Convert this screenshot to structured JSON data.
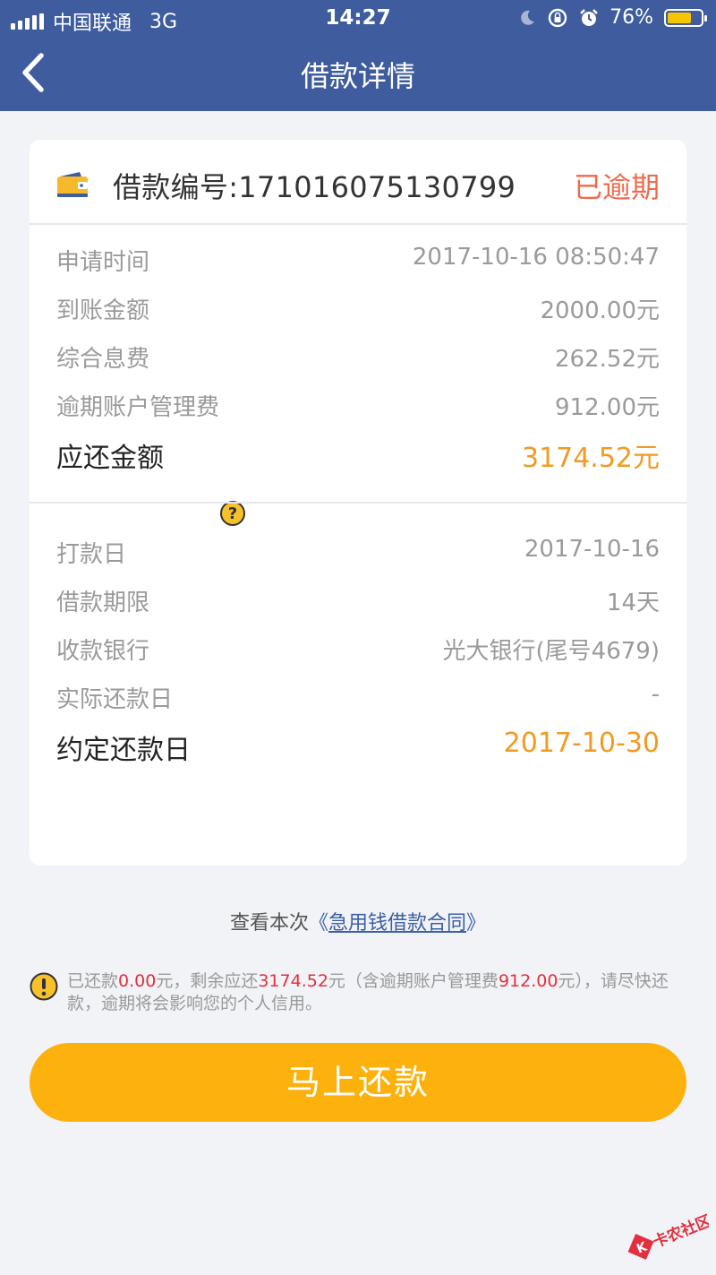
{
  "status_bar": {
    "carrier": "中国联通",
    "network": "3G",
    "time": "14:27",
    "battery": "76%",
    "battery_level": 0.76
  },
  "nav": {
    "title": "借款详情"
  },
  "card": {
    "loan_no": "借款编号:171016075130799",
    "status": "已逾期",
    "section1": [
      {
        "label": "申请时间",
        "value": "2017-10-16 08:50:47"
      },
      {
        "label": "到账金额",
        "value": "2000.00元"
      },
      {
        "label": "综合息费",
        "value": "262.52元"
      },
      {
        "label": "逾期账户管理费",
        "value": "912.00元"
      }
    ],
    "total": {
      "label": "应还金额",
      "value": "3174.52元"
    },
    "section2": [
      {
        "label": "打款日",
        "value": "2017-10-16"
      },
      {
        "label": "借款期限",
        "value": "14天"
      },
      {
        "label": "收款银行",
        "value": "光大银行(尾号4679)"
      },
      {
        "label": "实际还款日",
        "value": "-"
      }
    ],
    "due": {
      "label": "约定还款日",
      "value": "2017-10-30"
    }
  },
  "contract": {
    "prefix": "查看本次",
    "open": "《",
    "link": "急用钱借款合同",
    "close": "》"
  },
  "notice": {
    "p1": "已还款",
    "paid": "0.00",
    "p2": "元，剩余应还",
    "remaining": "3174.52",
    "p3": "元（含逾期账户管理费",
    "fee": "912.00",
    "p4": "元），请尽快还款，逾期将会影响您的个人信用。"
  },
  "button": {
    "pay": "马上还款"
  },
  "watermark": {
    "text": "卡农社区"
  },
  "colors": {
    "header": "#3e5c9e",
    "overdue": "#f06a4c",
    "amount": "#f39a22",
    "button": "#fcb10d",
    "link": "#3b5fa7",
    "highlight": "#e2303f"
  }
}
